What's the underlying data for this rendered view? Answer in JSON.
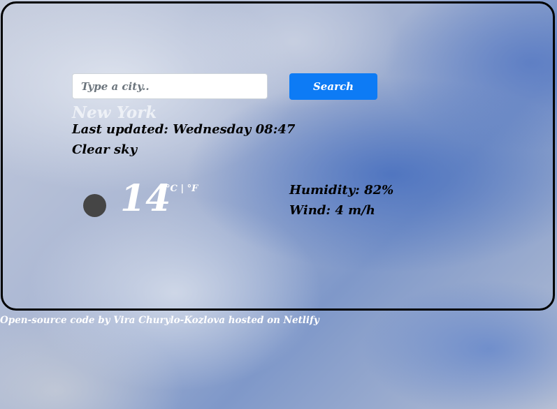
{
  "search": {
    "placeholder": "Type a city..",
    "value": "",
    "button_label": "Search"
  },
  "weather": {
    "city": "New York",
    "last_updated": "Last updated: Wednesday 08:47",
    "description": "Clear sky",
    "temperature": "14",
    "unit_celsius": "°C",
    "unit_separator": " | ",
    "unit_fahrenheit": "°F",
    "humidity": "Humidity: 82%",
    "wind": "Wind: 4 m/h",
    "icon": "weather-icon"
  },
  "footer": {
    "code_link": "Open-source code",
    "by_text": " by Vira Churylo-Kozlova ",
    "hosted_link": "hosted on Netlify"
  },
  "colors": {
    "button": "#0d7bf5",
    "card_border": "#000000",
    "city_text": "#eef1f7"
  }
}
